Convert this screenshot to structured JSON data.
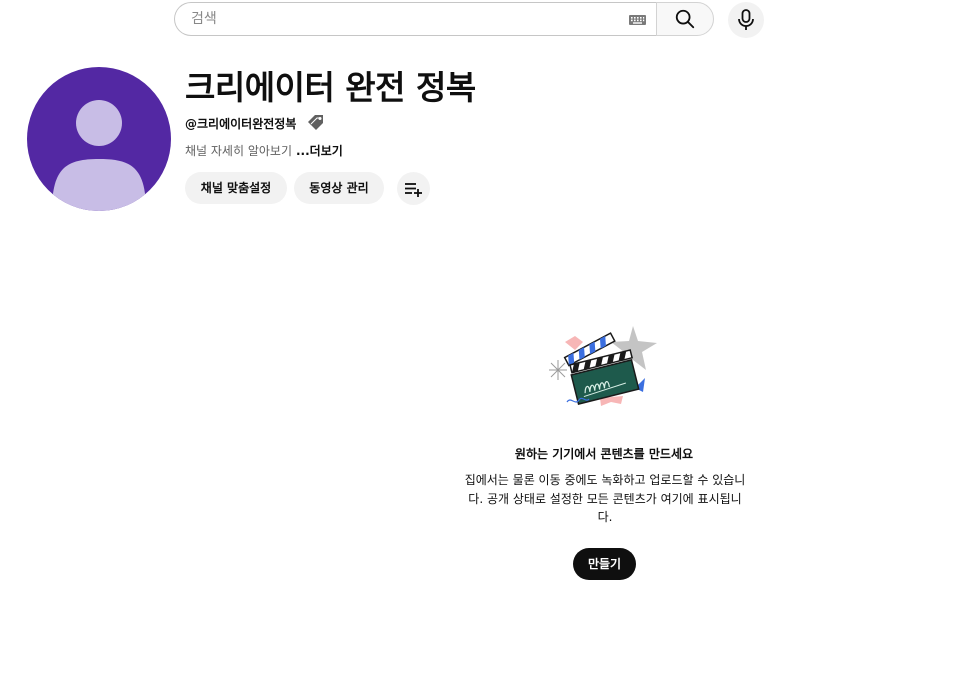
{
  "search": {
    "placeholder": "검색",
    "value": "",
    "keyboard_icon": "keyboard-icon",
    "search_icon": "search-icon",
    "mic_icon": "microphone-icon"
  },
  "channel": {
    "title": "크리에이터 완전 정복",
    "handle": "@크리에이터완전정복",
    "handle_icon": "tag-icon",
    "description": "채널 자세히 알아보기",
    "more_label": "...더보기",
    "avatar_bg": "#5328a3",
    "avatar_fg": "#c8bde6",
    "buttons": {
      "customize": "채널 맞춤설정",
      "manage_videos": "동영상 관리",
      "add_icon": "playlist-add-icon"
    }
  },
  "empty_state": {
    "illustration": "clapperboard-illustration",
    "title": "원하는 기기에서 콘텐츠를 만드세요",
    "description": "집에서는 물론 이동 중에도 녹화하고 업로드할 수 있습니다. 공개 상태로 설정한 모든 콘텐츠가 여기에 표시됩니다.",
    "create_label": "만들기"
  },
  "colors": {
    "button_bg": "#f2f2f2",
    "primary_dark": "#0f0f0f",
    "secondary_text": "#606060"
  }
}
